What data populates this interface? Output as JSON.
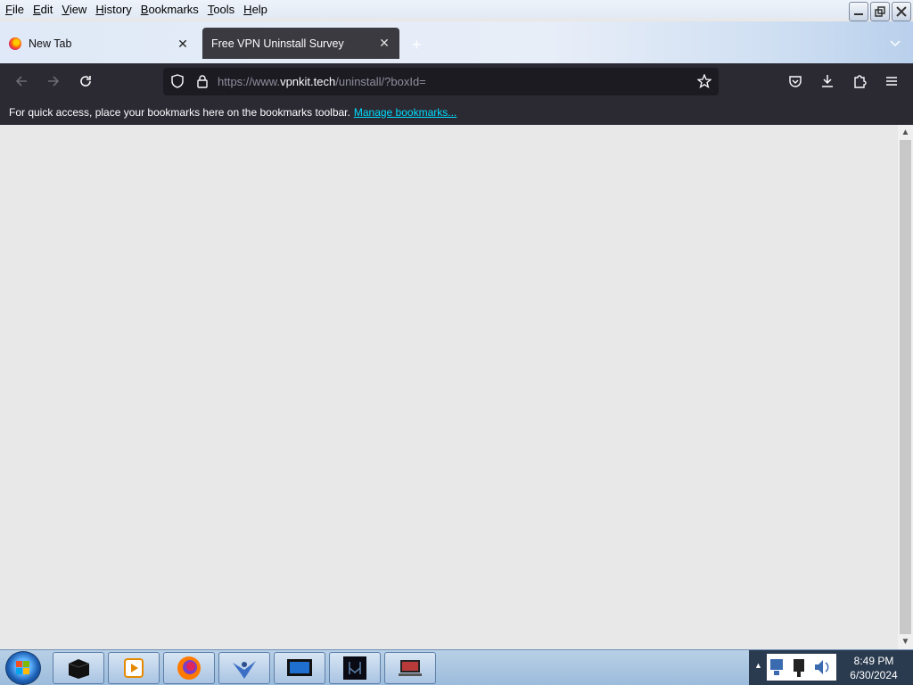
{
  "menu": {
    "items": [
      {
        "label": "File"
      },
      {
        "label": "Edit"
      },
      {
        "label": "View"
      },
      {
        "label": "History"
      },
      {
        "label": "Bookmarks"
      },
      {
        "label": "Tools"
      },
      {
        "label": "Help"
      }
    ]
  },
  "tabs": [
    {
      "title": "New Tab",
      "active": false
    },
    {
      "title": "Free VPN Uninstall Survey",
      "active": true
    }
  ],
  "nav": {
    "url_prefix": "https://www.",
    "url_host": "vpnkit.tech",
    "url_path": "/uninstall/?boxId="
  },
  "bookmarks_bar": {
    "text": "For quick access, place your bookmarks here on the bookmarks toolbar.",
    "link": "Manage bookmarks..."
  },
  "taskbar": {
    "apps": [
      {
        "icon": "black-box-icon"
      },
      {
        "icon": "media-player-icon"
      },
      {
        "icon": "firefox-icon"
      },
      {
        "icon": "bird-app-icon"
      },
      {
        "icon": "monitor-icon"
      },
      {
        "icon": "dark-app-icon"
      },
      {
        "icon": "laptop-icon"
      }
    ],
    "time": "8:49 PM",
    "date": "6/30/2024"
  },
  "colors": {
    "toolbar_bg": "#2b2a33",
    "urlbar_bg": "#1c1b22",
    "link": "#00ddff",
    "content_bg": "#e8e8e8"
  }
}
